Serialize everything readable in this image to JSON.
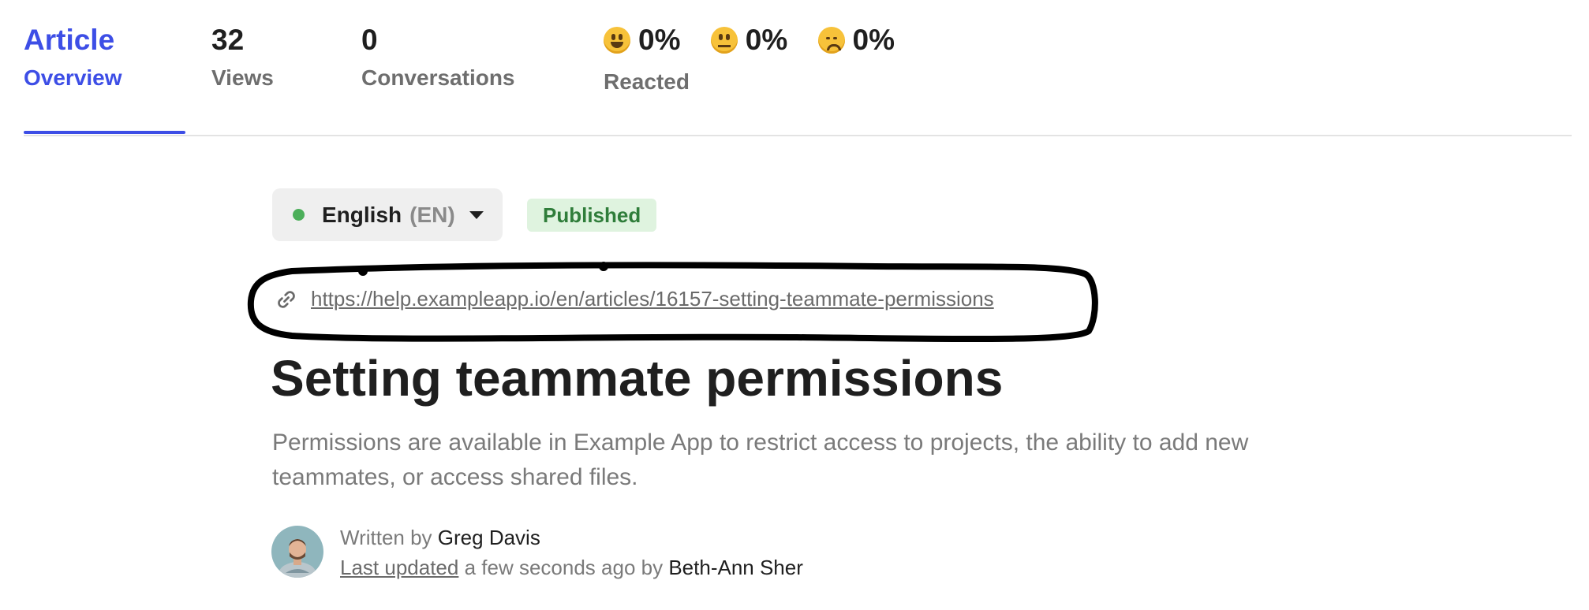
{
  "stats": {
    "article": {
      "title": "Article",
      "subtitle": "Overview"
    },
    "views": {
      "value": "32",
      "label": "Views"
    },
    "conversations": {
      "value": "0",
      "label": "Conversations"
    },
    "reacted": {
      "label": "Reacted",
      "reactions": [
        {
          "icon": "smiley-happy-icon",
          "value": "0%"
        },
        {
          "icon": "smiley-neutral-icon",
          "value": "0%"
        },
        {
          "icon": "smiley-sad-icon",
          "value": "0%"
        }
      ]
    }
  },
  "language": {
    "name": "English",
    "code": "(EN)"
  },
  "status": {
    "label": "Published",
    "color": "#2f7d3a",
    "background": "#dff3df"
  },
  "article": {
    "url": "https://help.exampleapp.io/en/articles/16157-setting-teammate-permissions",
    "title": "Setting teammate permissions",
    "description": "Permissions are available in Example App to restrict access to projects, the ability to add new teammates, or access shared files.",
    "written_by_label": "Written by",
    "author": "Greg Davis",
    "last_updated_label": "Last updated",
    "updated_time": "a few seconds ago by",
    "updated_by": "Beth-Ann Sher"
  },
  "colors": {
    "accent": "#3d4ee6",
    "status_dot": "#4caf5a"
  }
}
